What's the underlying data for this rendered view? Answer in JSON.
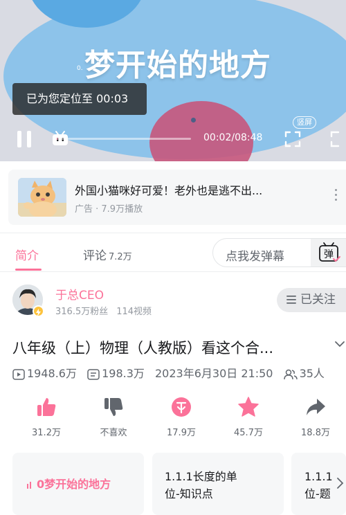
{
  "player": {
    "video_title": "梦开始的地方",
    "dot_label": "0.",
    "toast": "已为您定位至 00:03",
    "portrait_label": "竖屏",
    "time": "00:02/08:48",
    "progress": 0.004
  },
  "ad": {
    "title": "外国小猫咪好可爱！老外也是逃不出...",
    "meta": "广告 · 7.9万播放"
  },
  "tabs": {
    "intro": "简介",
    "comments": "评论",
    "comments_count": "7.2万",
    "danmaku_placeholder": "点我发弹幕",
    "danmaku_btn": "弹"
  },
  "uploader": {
    "name": "于总CEO",
    "fans": "316.5万粉丝",
    "videos": "114视频",
    "follow_label": "已关注"
  },
  "video": {
    "title": "八年级（上）物理（人教版）看这个合...",
    "plays": "1948.6万",
    "danmaku": "198.3万",
    "date": "2023年6月30日 21:50",
    "watching": "35人"
  },
  "actions": {
    "like": "31.2万",
    "dislike": "不喜欢",
    "coin": "17.9万",
    "fav": "45.7万",
    "share": "18.8万"
  },
  "episodes": [
    {
      "label": "0梦开始的地方"
    },
    {
      "label": "1.1.1长度的单位-知识点"
    },
    {
      "label": "1.1.1位-题"
    }
  ],
  "colors": {
    "accent": "#fb7299",
    "text_primary": "#18191c",
    "text_secondary": "#61666d",
    "text_muted": "#9499a0"
  }
}
